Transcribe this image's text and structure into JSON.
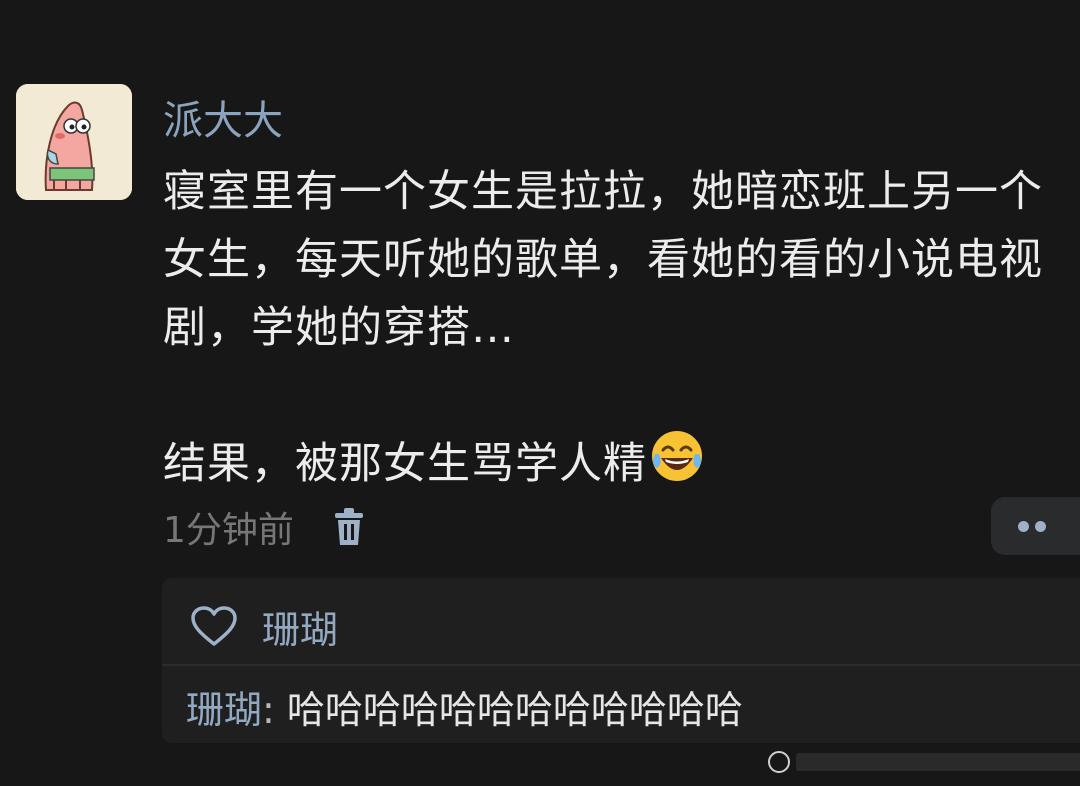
{
  "post": {
    "author": "派大大",
    "paragraph1": "寝室里有一个女生是拉拉，她暗恋班上另一个女生，每天听她的歌单，看她的看的小说电视剧，学她的穿搭…",
    "paragraph2": "结果，被那女生骂学人精",
    "emoji": "face-with-tears-of-joy",
    "time": "1分钟前"
  },
  "likes": {
    "user": "珊瑚"
  },
  "reply": {
    "user": "珊瑚",
    "separator": ":",
    "text": "哈哈哈哈哈哈哈哈哈哈哈哈"
  },
  "colors": {
    "background": "#171717",
    "name_link": "#8ba3bc",
    "body_text": "#ececec",
    "muted": "#777777",
    "reply_panel": "#1f1f1f"
  }
}
